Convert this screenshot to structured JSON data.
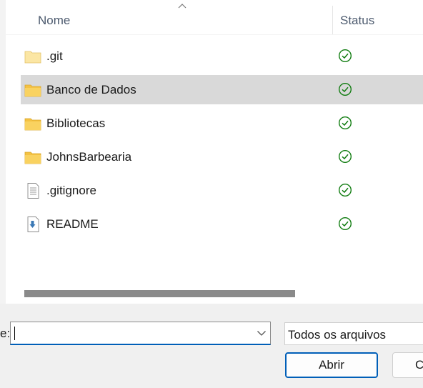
{
  "columns": {
    "name": "Nome",
    "status": "Status"
  },
  "files": [
    {
      "name": ".git",
      "icon": "folder-icon",
      "status": "synced-check-icon"
    },
    {
      "name": "Banco de Dados",
      "icon": "folder-icon",
      "status": "synced-check-icon",
      "selected": true
    },
    {
      "name": "Bibliotecas",
      "icon": "folder-icon",
      "status": "synced-check-icon"
    },
    {
      "name": "JohnsBarbearia",
      "icon": "folder-icon",
      "status": "synced-check-icon"
    },
    {
      "name": ".gitignore",
      "icon": "text-file-icon",
      "status": "synced-check-icon"
    },
    {
      "name": "README",
      "icon": "download-file-icon",
      "status": "synced-check-icon"
    }
  ],
  "footer": {
    "filename_label": "e:",
    "filename_value": "",
    "filter_value": "Todos os arquivos",
    "open_label": "Abrir",
    "cancel_label": "C"
  },
  "colors": {
    "accent": "#005fb8",
    "selection": "#d9d9d9",
    "folder": "#f4c243",
    "status_green": "#107c10"
  }
}
